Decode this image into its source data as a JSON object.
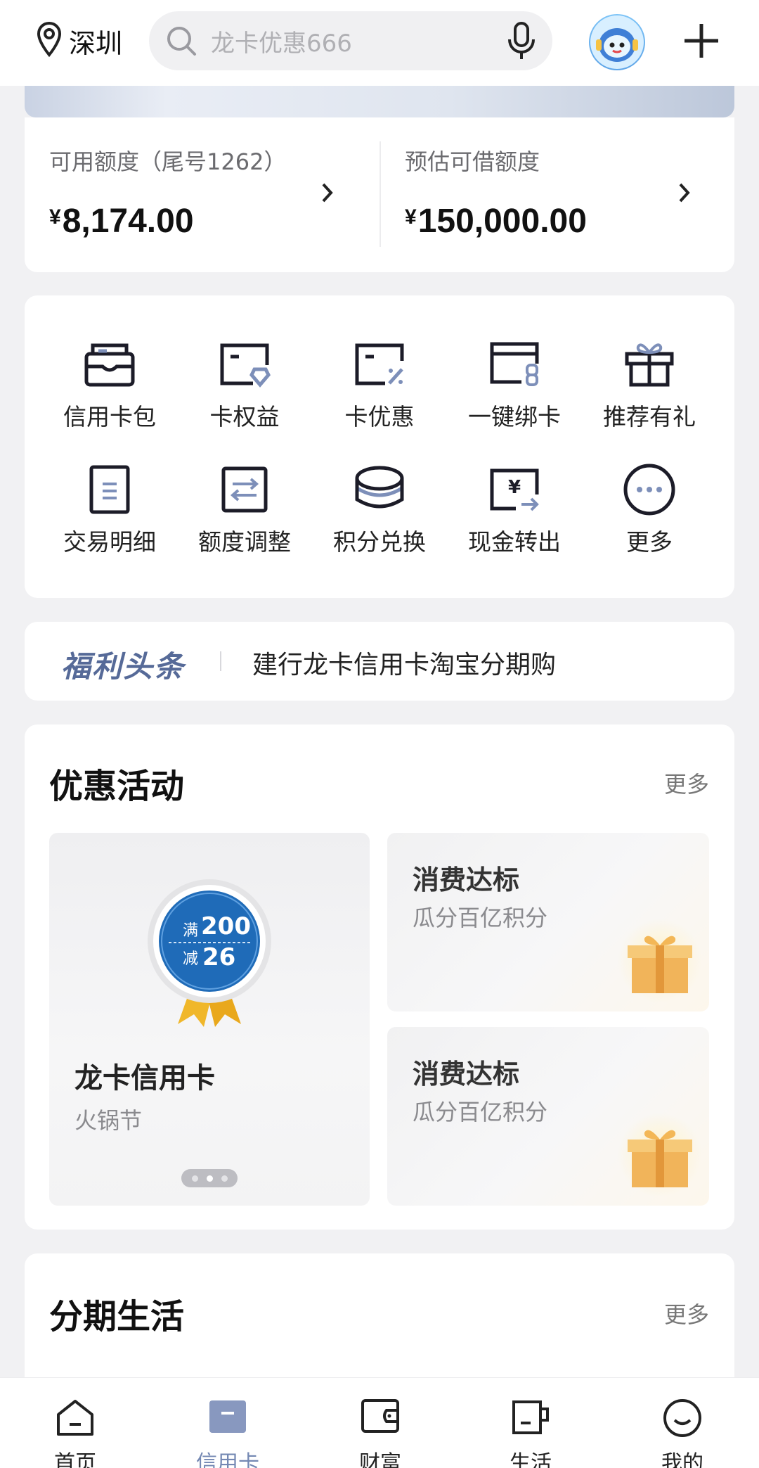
{
  "topbar": {
    "location": "深圳",
    "search_placeholder": "龙卡优惠666"
  },
  "credit": {
    "available_label": "可用额度（尾号1262）",
    "available_amount": "8,174.00",
    "loan_label": "预估可借额度",
    "loan_amount": "150,000.00",
    "currency_symbol": "¥"
  },
  "services": [
    {
      "label": "信用卡包",
      "icon": "card-wallet-icon"
    },
    {
      "label": "卡权益",
      "icon": "card-benefit-icon"
    },
    {
      "label": "卡优惠",
      "icon": "card-discount-icon"
    },
    {
      "label": "一键绑卡",
      "icon": "bind-card-icon"
    },
    {
      "label": "推荐有礼",
      "icon": "gift-icon"
    },
    {
      "label": "交易明细",
      "icon": "transaction-detail-icon"
    },
    {
      "label": "额度调整",
      "icon": "limit-adjust-icon"
    },
    {
      "label": "积分兑换",
      "icon": "points-exchange-icon"
    },
    {
      "label": "现金转出",
      "icon": "cash-transfer-icon"
    },
    {
      "label": "更多",
      "icon": "more-icon"
    }
  ],
  "headline": {
    "brand": "福利头条",
    "text": "建行龙卡信用卡淘宝分期购"
  },
  "promo": {
    "title": "优惠活动",
    "more": "更多",
    "big_card": {
      "title": "龙卡信用卡",
      "subtitle": "火锅节",
      "badge_top_prefix": "满",
      "badge_top_value": "200",
      "badge_bottom_prefix": "减",
      "badge_bottom_value": "26"
    },
    "small_cards": [
      {
        "title": "消费达标",
        "subtitle": "瓜分百亿积分"
      },
      {
        "title": "消费达标",
        "subtitle": "瓜分百亿积分"
      }
    ]
  },
  "installment": {
    "title": "分期生活",
    "more": "更多"
  },
  "bottom_nav": [
    {
      "label": "首页",
      "icon": "home-icon"
    },
    {
      "label": "信用卡",
      "icon": "credit-card-icon"
    },
    {
      "label": "财富",
      "icon": "wallet-icon"
    },
    {
      "label": "生活",
      "icon": "cup-icon"
    },
    {
      "label": "我的",
      "icon": "smile-icon"
    }
  ],
  "colors": {
    "accent": "#7488b3",
    "background": "#f1f1f3"
  }
}
